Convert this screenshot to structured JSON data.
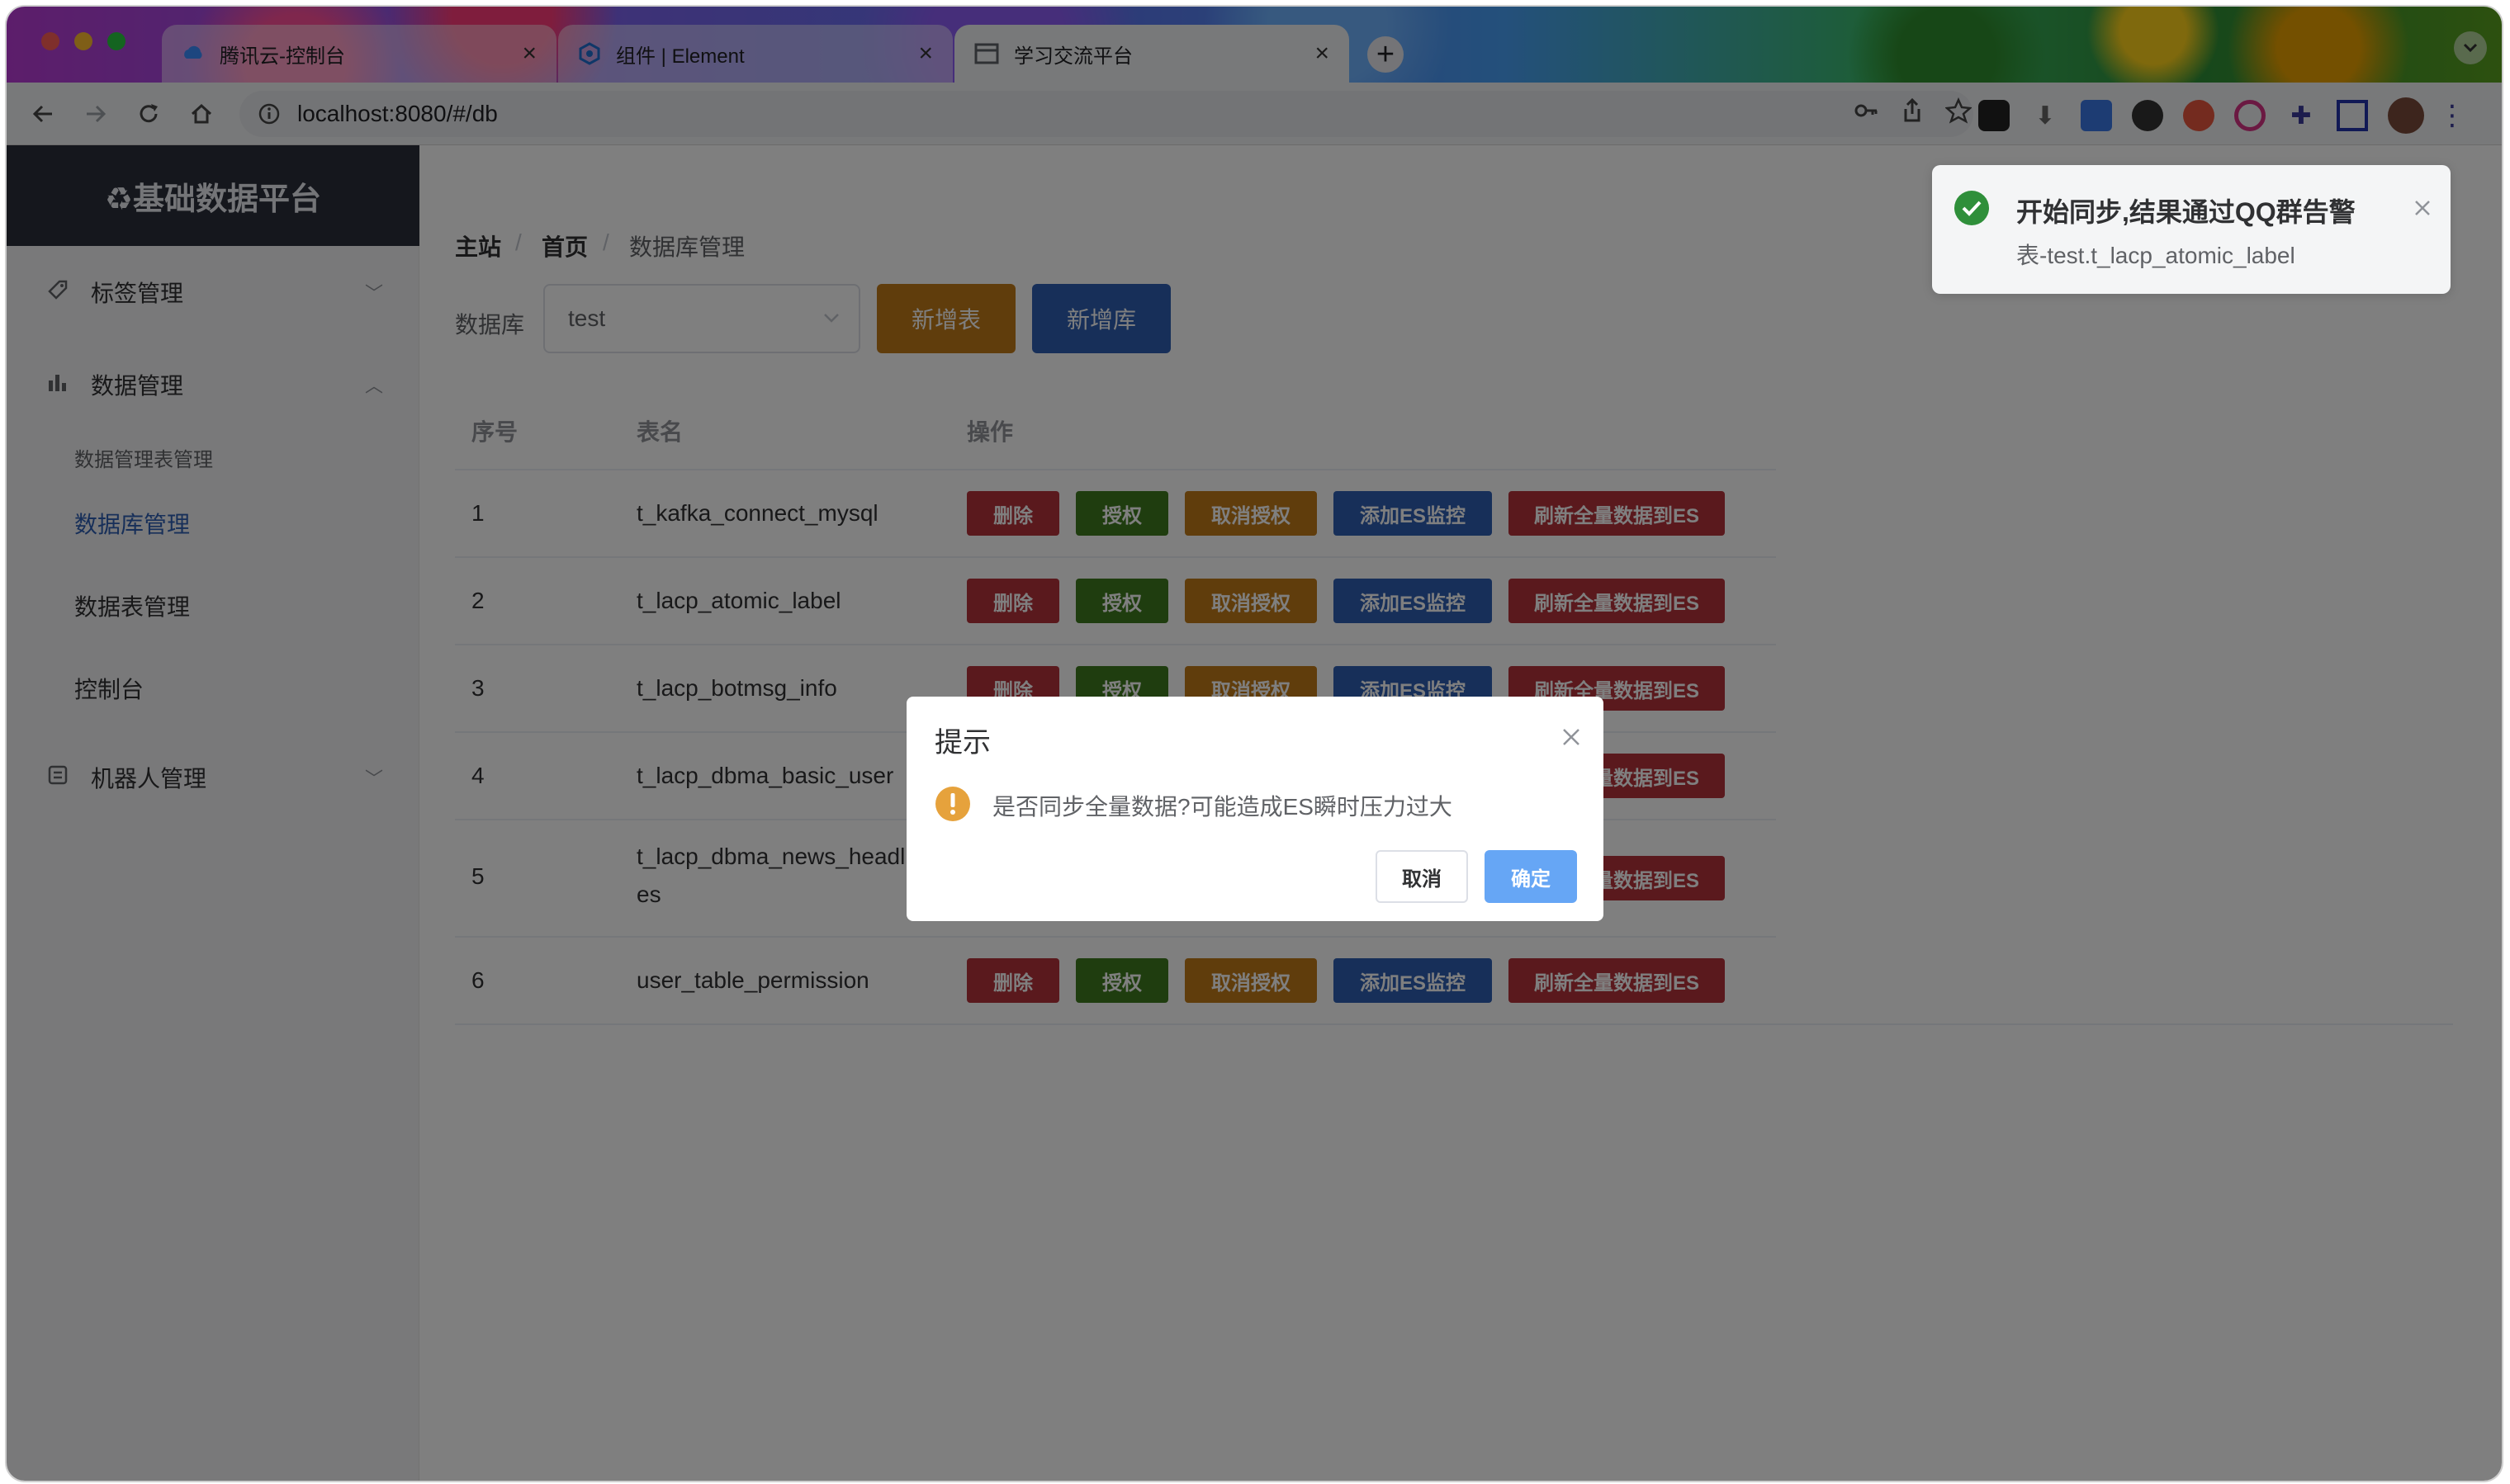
{
  "browser": {
    "tabs": [
      {
        "title": "腾讯云-控制台",
        "icon": "tencent-cloud-icon"
      },
      {
        "title": "组件 | Element",
        "icon": "element-logo-icon"
      },
      {
        "title": "学习交流平台",
        "icon": "page-icon"
      }
    ],
    "url": "localhost:8080/#/db",
    "new_tab_symbol": "+"
  },
  "sidebar": {
    "brand": "♻基础数据平台",
    "menus": [
      {
        "label": "标签管理",
        "icon": "tag-icon",
        "expanded": false
      },
      {
        "label": "数据管理",
        "icon": "bar-chart-icon",
        "expanded": true,
        "children": [
          "数据管理表管理",
          "数据库管理",
          "数据表管理",
          "控制台"
        ]
      },
      {
        "label": "机器人管理",
        "icon": "robot-icon",
        "expanded": false
      }
    ],
    "active_child": "数据库管理"
  },
  "breadcrumb": {
    "items": [
      "主站",
      "首页",
      "数据库管理"
    ],
    "separator": "/"
  },
  "filter": {
    "label": "数据库",
    "selected_db": "test",
    "add_table_label": "新增表",
    "add_db_label": "新增库"
  },
  "table": {
    "headers": [
      "序号",
      "表名",
      "操作"
    ],
    "rows": [
      {
        "index": "1",
        "name": "t_kafka_connect_mysql"
      },
      {
        "index": "2",
        "name": "t_lacp_atomic_label"
      },
      {
        "index": "3",
        "name": "t_lacp_botmsg_info"
      },
      {
        "index": "4",
        "name": "t_lacp_dbma_basic_user"
      },
      {
        "index": "5",
        "name": "t_lacp_dbma_news_headl",
        "name_line2": "es"
      },
      {
        "index": "6",
        "name": "user_table_permission"
      }
    ],
    "actions": {
      "delete": "删除",
      "grant": "授权",
      "revoke": "取消授权",
      "add_es": "添加ES监控",
      "refresh_es": "刷新全量数据到ES"
    }
  },
  "dialog": {
    "title": "提示",
    "message": "是否同步全量数据?可能造成ES瞬时压力过大",
    "cancel_label": "取消",
    "confirm_label": "确定"
  },
  "toast": {
    "title": "开始同步,结果通过QQ群告警",
    "message": "表-test.t_lacp_atomic_label"
  },
  "colors": {
    "primary": "#2f5fb3",
    "warning": "#c17a19",
    "danger": "#b5323a",
    "success": "#3f7a1e",
    "dialog_confirm": "#66a6f5",
    "success_icon": "#2f8f3a",
    "warning_icon": "#e6a23c"
  }
}
